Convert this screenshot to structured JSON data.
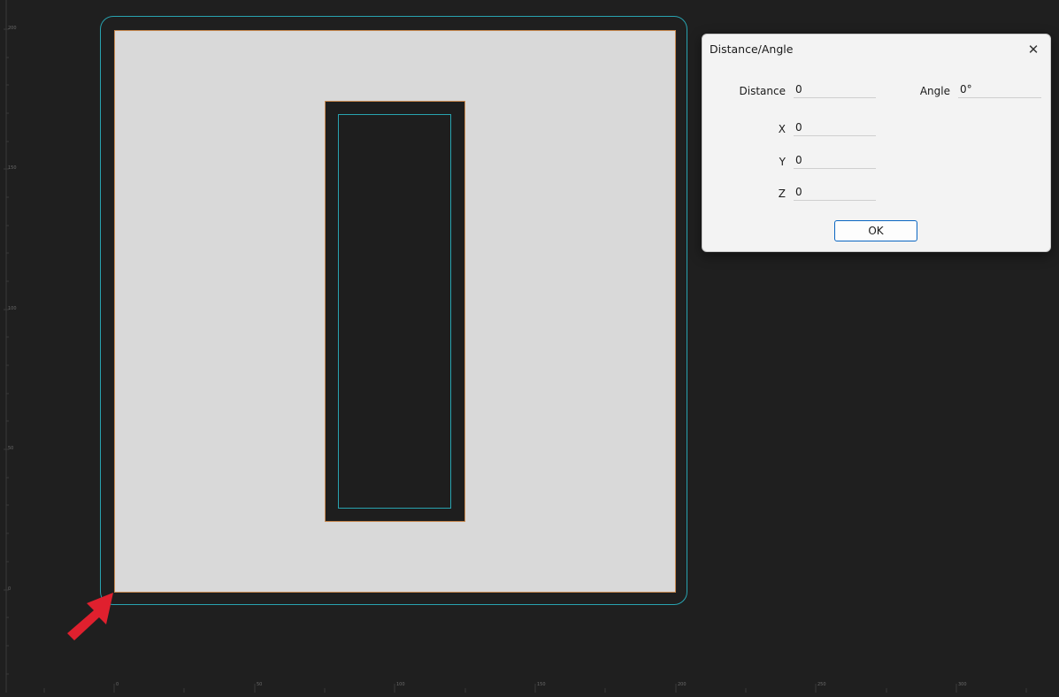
{
  "ruler": {
    "left_labels": [
      "200",
      "150",
      "100",
      "50",
      "0"
    ],
    "bottom_labels": [
      "0",
      "50",
      "100",
      "150",
      "200",
      "250",
      "300"
    ]
  },
  "dialog": {
    "title": "Distance/Angle",
    "close_glyph": "✕",
    "distance_label": "Distance",
    "distance_value": "0",
    "angle_label": "Angle",
    "angle_value": "0°",
    "x_label": "X",
    "x_value": "0",
    "y_label": "Y",
    "y_value": "0",
    "z_label": "Z",
    "z_value": "0",
    "ok_label": "OK"
  },
  "colors": {
    "background": "#1f1f1f",
    "plate": "#d9d9d9",
    "plate_edge": "#c6874e",
    "offset_path": "#28a3b0",
    "highlight": "#e0202e",
    "arrow": "#e0202e"
  },
  "icons": {
    "close": "close-icon",
    "origin_marker": "origin-arrow-icon"
  }
}
